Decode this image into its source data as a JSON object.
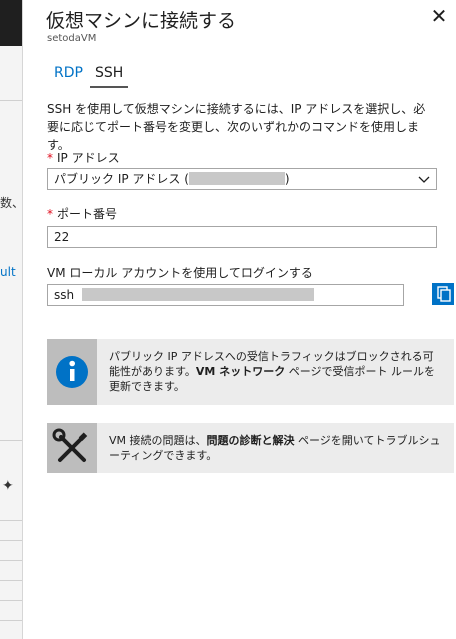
{
  "background": {
    "fragments": [
      "数、",
      "ult"
    ]
  },
  "blade": {
    "title": "仮想マシンに接続する",
    "subtitle": "setodaVM",
    "close_glyph": "✕"
  },
  "tabs": [
    {
      "label": "RDP",
      "active": false
    },
    {
      "label": "SSH",
      "active": true
    }
  ],
  "description": "SSH を使用して仮想マシンに接続するには、IP アドレスを選択し、必要に応じてポート番号を変更し、次のいずれかのコマンドを使用します。",
  "ip": {
    "required_mark": "*",
    "label": "IP アドレス",
    "selected_prefix": "パブリック IP アドレス (",
    "selected_suffix": ")"
  },
  "port": {
    "required_mark": "*",
    "label": "ポート番号",
    "value": "22"
  },
  "command": {
    "label": "VM ローカル アカウントを使用してログインする",
    "prefix": "ssh"
  },
  "info1": {
    "part1": "パブリック IP アドレスへの受信トラフィックはブロックされる可能性があります。",
    "bold": "VM ネットワーク",
    "part2": " ページで受信ポート ルールを更新できます。"
  },
  "info2": {
    "part1": "VM 接続の問題は、",
    "bold": "問題の診断と解決",
    "part2": " ページを開いてトラブルシューティングできます。"
  },
  "colors": {
    "accent": "#0072c6",
    "required": "#e00b1c",
    "info_bg": "#ececec",
    "icon_bg": "#bdbdbd"
  }
}
